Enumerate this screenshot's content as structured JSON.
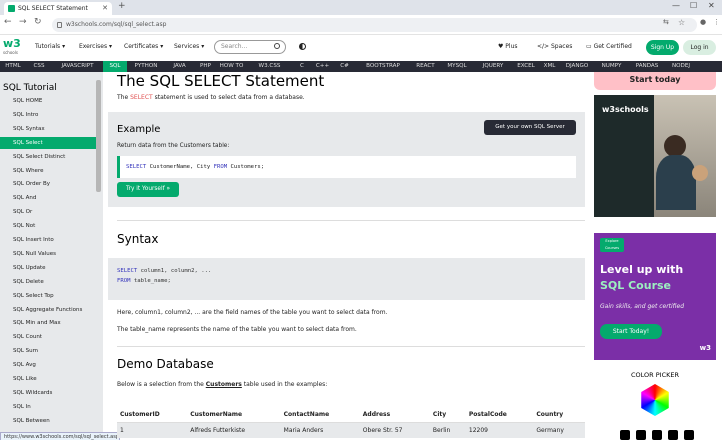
{
  "browser": {
    "tab_title": "SQL SELECT Statement",
    "url": "w3schools.com/sql/sql_select.asp"
  },
  "header": {
    "logo": "w3",
    "logo_sub": "schools",
    "menu": [
      "Tutorials",
      "Exercises",
      "Certificates",
      "Services"
    ],
    "search_placeholder": "Search...",
    "plus": "Plus",
    "spaces": "Spaces",
    "get_certified": "Get Certified",
    "signup": "Sign Up",
    "login": "Log in"
  },
  "topics": [
    "HTML",
    "CSS",
    "JAVASCRIPT",
    "SQL",
    "PYTHON",
    "JAVA",
    "PHP",
    "HOW TO",
    "W3.CSS",
    "C",
    "C++",
    "C#",
    "BOOTSTRAP",
    "REACT",
    "MYSQL",
    "JQUERY",
    "EXCEL",
    "XML",
    "DJANGO",
    "NUMPY",
    "PANDAS",
    "NODEJ"
  ],
  "sidebar": {
    "title": "SQL Tutorial",
    "items": [
      "SQL HOME",
      "SQL Intro",
      "SQL Syntax",
      "SQL Select",
      "SQL Select Distinct",
      "SQL Where",
      "SQL Order By",
      "SQL And",
      "SQL Or",
      "SQL Not",
      "SQL Insert Into",
      "SQL Null Values",
      "SQL Update",
      "SQL Delete",
      "SQL Select Top",
      "SQL Aggregate Functions",
      "SQL Min and Max",
      "SQL Count",
      "SQL Sum",
      "SQL Avg",
      "SQL Like",
      "SQL Wildcards",
      "SQL In",
      "SQL Between"
    ],
    "status_url": "https://www.w3schools.com/sql/sql_select.asp"
  },
  "main": {
    "title": "The SQL SELECT Statement",
    "intro_pre": "The",
    "intro_kw": "SELECT",
    "intro_post": "statement is used to select data from a database.",
    "example_title": "Example",
    "get_server": "Get your own SQL Server",
    "example_sub": "Return data from the Customers table:",
    "example_code_select": "SELECT",
    "example_code_mid": "CustomerName, City",
    "example_code_from": "FROM",
    "example_code_end": "Customers;",
    "tryit": "Try it Yourself »",
    "syntax_title": "Syntax",
    "syntax_line1_kw": "SELECT",
    "syntax_line1": "column1, column2, ...",
    "syntax_line2_kw": "FROM",
    "syntax_line2": "table_name;",
    "para1": "Here, column1, column2, ... are the field names of the table you want to select data from.",
    "para2": "The table_name represents the name of the table you want to select data from.",
    "demo_title": "Demo Database",
    "demo_pre": "Below is a selection from the",
    "demo_link": "Customers",
    "demo_post": "table used in the examples:",
    "table": {
      "headers": [
        "CustomerID",
        "CustomerName",
        "ContactName",
        "Address",
        "City",
        "PostalCode",
        "Country"
      ],
      "rows": [
        [
          "1",
          "Alfreds Futterkiste",
          "Maria Anders",
          "Obere Str. 57",
          "Berlin",
          "12209",
          "Germany"
        ]
      ]
    }
  },
  "right": {
    "start_today": "Start today",
    "ad_logo": "w3schools",
    "level_up_1": "Level up with",
    "level_up_2": "SQL Course",
    "level_sub": "Gain skills, and get certified",
    "start_btn": "Start Today!",
    "color_picker": "COLOR PICKER",
    "ad_badge": "Explore Courses",
    "ad3_logo": "w3"
  },
  "colors": {
    "accent": "#04aa6d",
    "topics_bg": "#282a35",
    "sidebar_bg": "#e7e9eb",
    "keyword": "#e05050"
  }
}
